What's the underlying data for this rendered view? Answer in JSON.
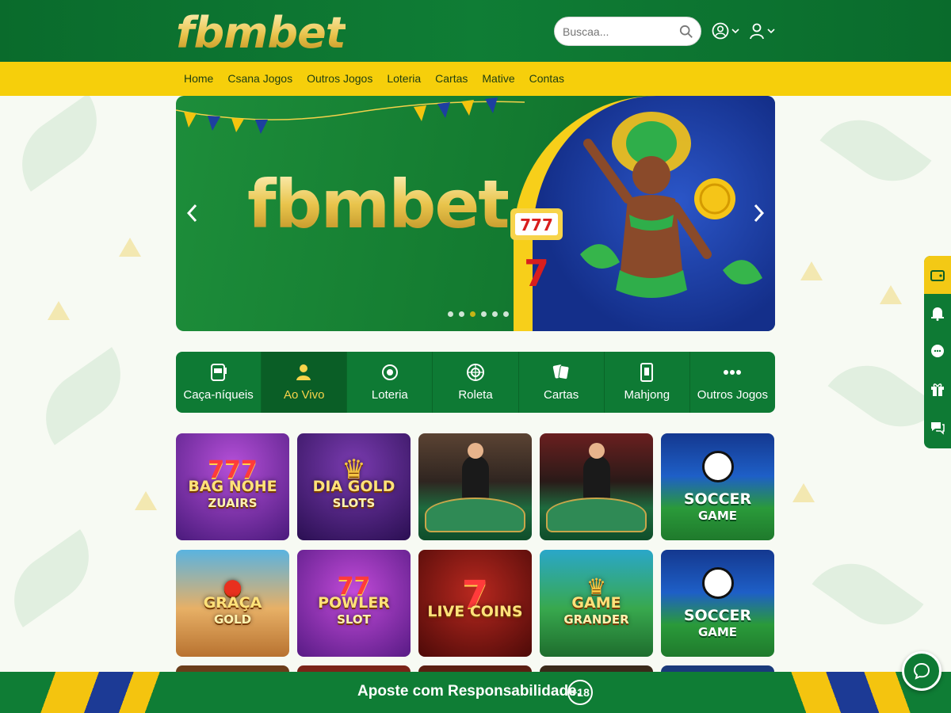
{
  "brand": {
    "logo_text": "fbmbet",
    "banner_text": "fbmbet"
  },
  "search": {
    "placeholder": "Buscaa..."
  },
  "nav": {
    "items": [
      "Home",
      "Csana Jogos",
      "Outros Jogos",
      "Loteria",
      "Cartas",
      "Mative",
      "Contas"
    ]
  },
  "categories": [
    {
      "label": "Caça-níqueis",
      "icon": "slot-machine-icon",
      "active": false
    },
    {
      "label": "Ao Vivo",
      "icon": "live-dealer-icon",
      "active": true
    },
    {
      "label": "Loteria",
      "icon": "lottery-ball-icon",
      "active": false
    },
    {
      "label": "Roleta",
      "icon": "roulette-icon",
      "active": false
    },
    {
      "label": "Cartas",
      "icon": "cards-icon",
      "active": false
    },
    {
      "label": "Mahjong",
      "icon": "mahjong-tile-icon",
      "active": false
    },
    {
      "label": "Outros Jogos",
      "icon": "more-dots-icon",
      "active": false
    }
  ],
  "games": [
    {
      "title": "BAG NOHE",
      "subtitle": "ZUAIRS",
      "kind": "slot",
      "theme": "777"
    },
    {
      "title": "DIA GOLD",
      "subtitle": "SLOTS",
      "kind": "slot",
      "theme": "lion"
    },
    {
      "title": "",
      "subtitle": "",
      "kind": "live",
      "theme": "blackjack"
    },
    {
      "title": "",
      "subtitle": "",
      "kind": "live",
      "theme": "roulette-table"
    },
    {
      "title": "SOCCER",
      "subtitle": "GAME",
      "kind": "sport",
      "theme": "soccer"
    },
    {
      "title": "GRAÇA",
      "subtitle": "GOLD",
      "kind": "slot",
      "theme": "desert"
    },
    {
      "title": "POWLER",
      "subtitle": "SLOT",
      "kind": "slot",
      "theme": "77"
    },
    {
      "title": "LIVE COINS",
      "subtitle": "",
      "kind": "slot",
      "theme": "7"
    },
    {
      "title": "GAME",
      "subtitle": "GRANDER",
      "kind": "slot",
      "theme": "jungle"
    },
    {
      "title": "SOCCER",
      "subtitle": "GAME",
      "kind": "sport",
      "theme": "soccer"
    }
  ],
  "side_rail": [
    "wallet-icon",
    "bell-icon",
    "chat-bubbles-icon",
    "gift-icon",
    "support-chat-icon"
  ],
  "banner_dots": 6,
  "footer": {
    "message": "Aposte com Responsabilidade.",
    "age": "+18"
  },
  "colors": {
    "primary_green": "#0f7d35",
    "accent_yellow": "#f6cf0b",
    "gold": "#e8c24a"
  }
}
